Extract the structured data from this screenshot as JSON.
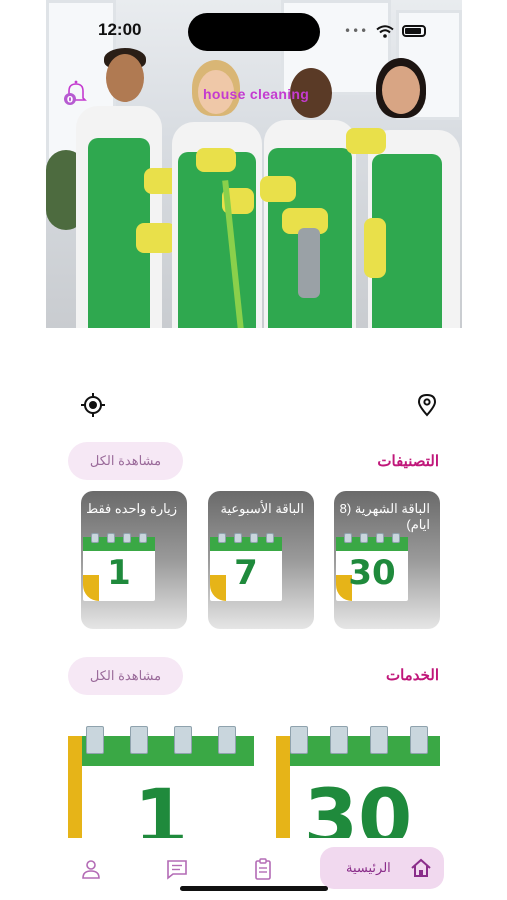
{
  "status_bar": {
    "time": "12:00"
  },
  "header": {
    "brand": "house cleaning"
  },
  "categories": {
    "title": "التصنيفات",
    "see_all": "مشاهدة الكل",
    "items": [
      {
        "label": "الباقة الشهرية (8 ايام)",
        "number": "30"
      },
      {
        "label": "الباقة الأسبوعية",
        "number": "7"
      },
      {
        "label": "زيارة واحده فقط",
        "number": "1"
      }
    ]
  },
  "services": {
    "title": "الخدمات",
    "see_all": "مشاهدة الكل",
    "items": [
      {
        "number": "30"
      },
      {
        "number": "1"
      }
    ]
  },
  "bottom_nav": {
    "home_label": "الرئيسية"
  },
  "colors": {
    "accent": "#c0177a",
    "pill_bg": "#f6e8f5",
    "calendar_green": "#3aa845",
    "calendar_yellow": "#e6b418"
  }
}
